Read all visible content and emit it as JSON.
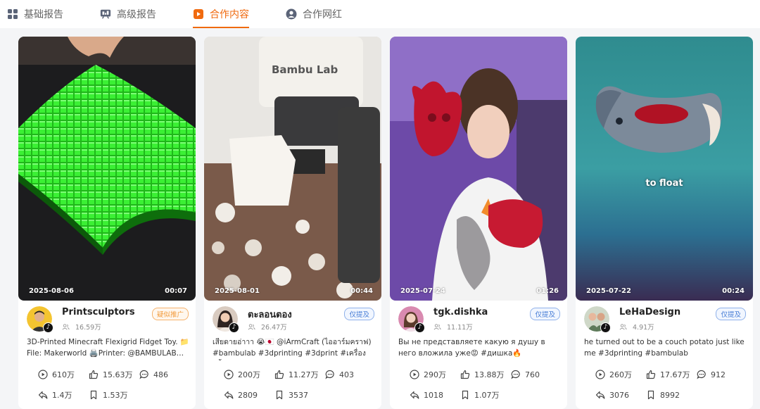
{
  "tabs": [
    {
      "label": "基础报告",
      "icon": "grid-icon"
    },
    {
      "label": "高级报告",
      "icon": "report-icon"
    },
    {
      "label": "合作内容",
      "icon": "video-icon",
      "active": true
    },
    {
      "label": "合作网红",
      "icon": "user-icon"
    }
  ],
  "accent_color": "#f06a0f",
  "cards": [
    {
      "date": "2025-08-06",
      "duration": "00:07",
      "overlay_text": "",
      "author": "Printsculptors",
      "fans": "16.59万",
      "tag": "疑似推广",
      "desc": "3D-Printed Minecraft Flexigrid Fidget Toy. 📁 File: Makerworld 🖨️Printer: @BAMBULAB…",
      "plays": "610万",
      "likes": "15.63万",
      "comments": "486",
      "shares": "1.4万",
      "saves": "1.53万"
    },
    {
      "date": "2025-08-01",
      "duration": "00:44",
      "overlay_text": "",
      "author": "ตะลอนตอง",
      "fans": "26.47万",
      "tag": "仅提及",
      "desc": "เสียดายอ่าาา 😭🇯🇵 @iArmCraft (ไออาร์มคราฟ) #bambulab #3dprinting #3dprint #เครื่องปริ้…",
      "plays": "200万",
      "likes": "11.27万",
      "comments": "403",
      "shares": "2809",
      "saves": "3537"
    },
    {
      "date": "2025-07-24",
      "duration": "01:26",
      "overlay_text": "",
      "author": "tgk.dishka",
      "fans": "11.11万",
      "tag": "仅提及",
      "desc": "Вы не представляете какую я душу в него вложила уже😡 #дишка🔥 #зимомо…",
      "plays": "290万",
      "likes": "13.88万",
      "comments": "760",
      "shares": "1018",
      "saves": "1.07万"
    },
    {
      "date": "2025-07-22",
      "duration": "00:24",
      "overlay_text": "to float",
      "author": "LeHaDesign",
      "fans": "4.91万",
      "tag": "仅提及",
      "desc": "he turned out to be a couch potato just like me #3dprinting #bambulab",
      "plays": "260万",
      "likes": "17.67万",
      "comments": "912",
      "shares": "3076",
      "saves": "8992"
    }
  ]
}
